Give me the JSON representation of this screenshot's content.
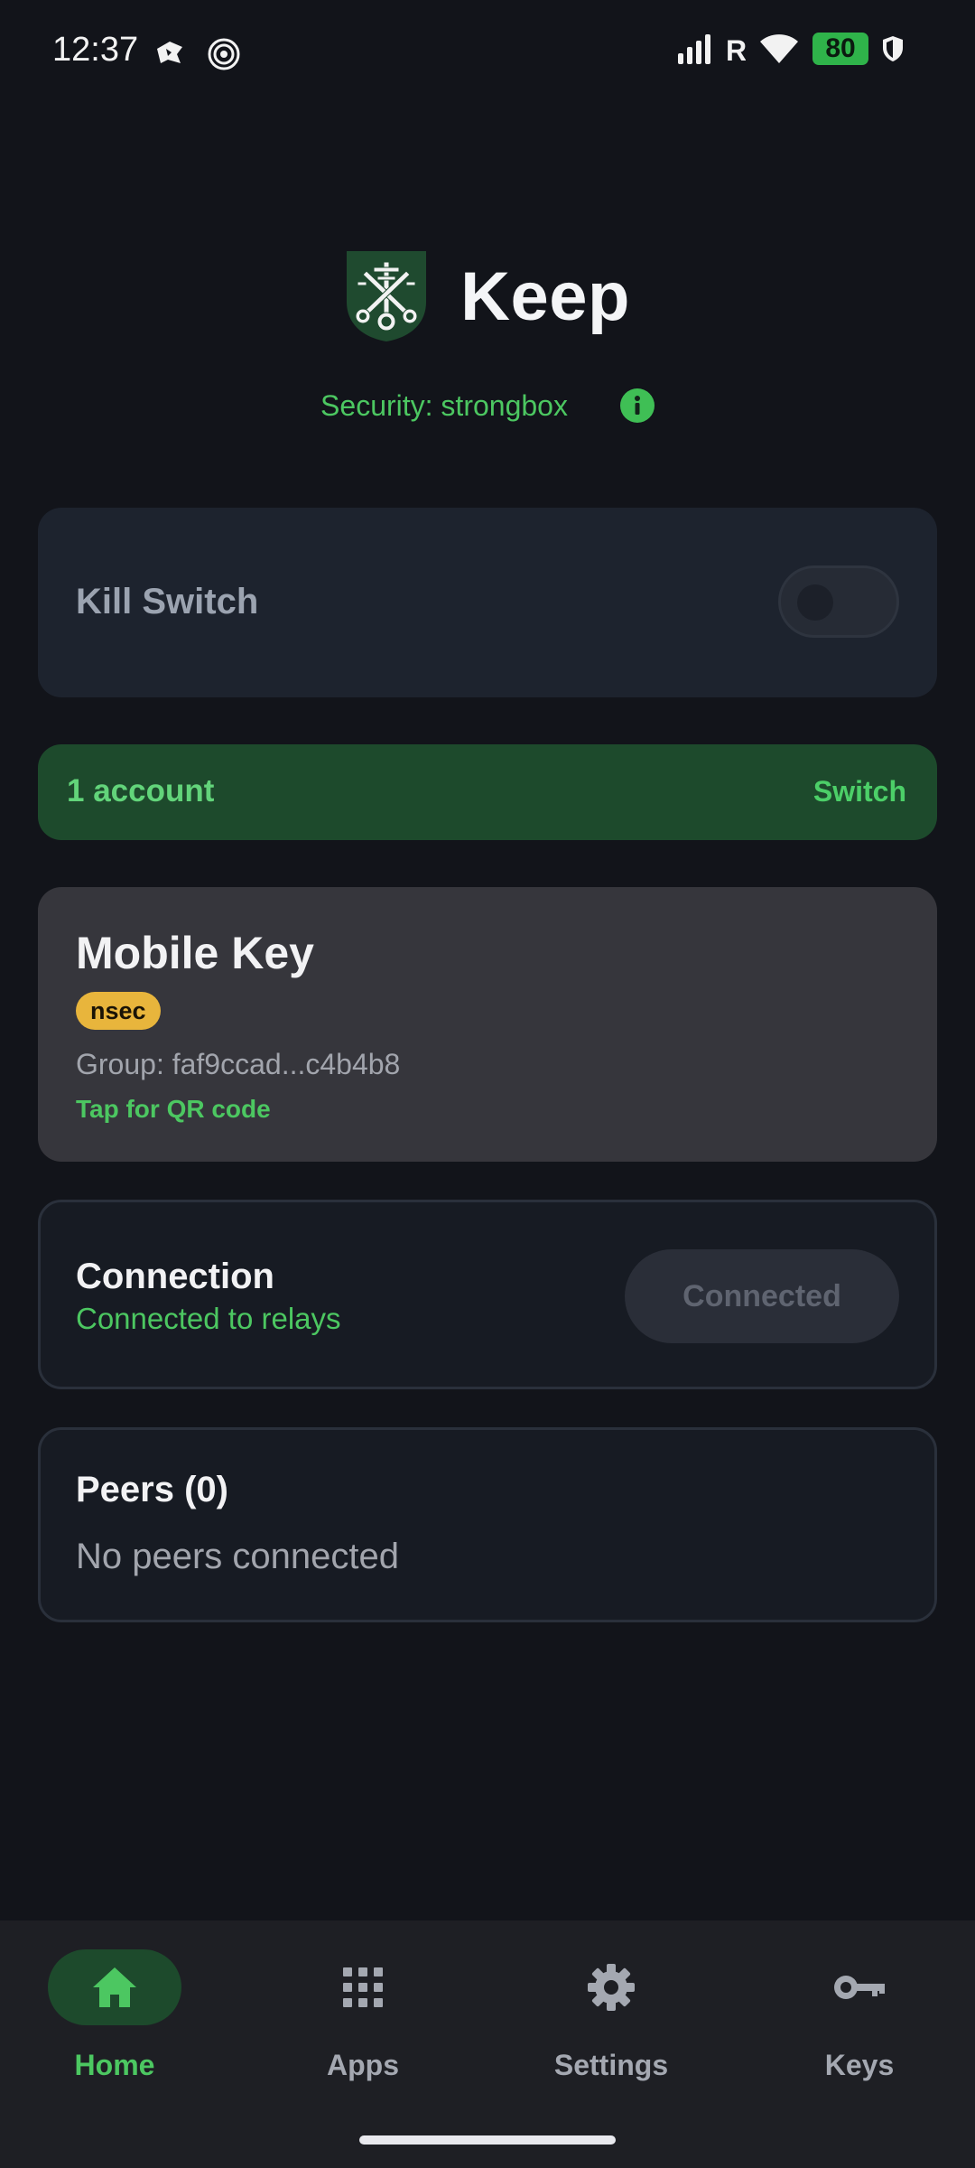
{
  "status_bar": {
    "time": "12:37",
    "battery_level": "80",
    "icons": [
      "notification-app-icon",
      "hotspot-icon",
      "signal-icon",
      "roaming-icon",
      "wifi-icon",
      "battery-icon",
      "shield-icon"
    ]
  },
  "header": {
    "title": "Keep",
    "security_text": "Security: strongbox"
  },
  "kill_switch": {
    "label": "Kill Switch",
    "enabled": false
  },
  "account": {
    "count_label": "1 account",
    "switch_label": "Switch"
  },
  "key_card": {
    "title": "Mobile Key",
    "badge": "nsec",
    "group": "Group: faf9ccad...c4b4b8",
    "qr_hint": "Tap for QR code"
  },
  "connection": {
    "title": "Connection",
    "status": "Connected to relays",
    "button_label": "Connected"
  },
  "peers": {
    "title": "Peers (0)",
    "empty_text": "No peers connected"
  },
  "nav": {
    "items": [
      {
        "label": "Home",
        "icon": "home-icon",
        "active": true
      },
      {
        "label": "Apps",
        "icon": "apps-grid-icon",
        "active": false
      },
      {
        "label": "Settings",
        "icon": "gear-icon",
        "active": false
      },
      {
        "label": "Keys",
        "icon": "key-icon",
        "active": false
      }
    ]
  },
  "colors": {
    "background": "#12141a",
    "accent_green": "#4cc761",
    "account_bar": "#1d4a2c",
    "badge_yellow": "#e8b53c"
  }
}
